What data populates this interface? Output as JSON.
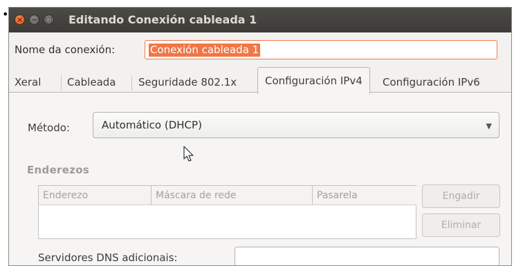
{
  "window": {
    "title": "Editando Conexión cableada 1",
    "controls": {
      "close": "×",
      "minimize": "−",
      "maximize": "□"
    }
  },
  "connection_name": {
    "label": "Nome da conexión:",
    "value": "Conexión cableada 1"
  },
  "tabs": [
    {
      "label": "Xeral",
      "active": false
    },
    {
      "label": "Cableada",
      "active": false
    },
    {
      "label": "Seguridade 802.1x",
      "active": false
    },
    {
      "label": "Configuración IPv4",
      "active": true
    },
    {
      "label": "Configuración IPv6",
      "active": false
    }
  ],
  "ipv4": {
    "method_label": "Método:",
    "method_value": "Automático (DHCP)",
    "addresses_label": "Enderezos",
    "columns": [
      "Enderezo",
      "Máscara de rede",
      "Pasarela"
    ],
    "add_button": "Engadir",
    "delete_button": "Eliminar",
    "dns_label": "Servidores DNS adicionais:",
    "dns_value": ""
  },
  "colors": {
    "accent": "#f07746",
    "titlebar": "#3c3b37",
    "close_button": "#df4a16"
  },
  "icons": [
    "bullet-icon",
    "close-icon",
    "minimize-icon",
    "maximize-icon",
    "dropdown-arrow-icon",
    "mouse-pointer-icon"
  ]
}
